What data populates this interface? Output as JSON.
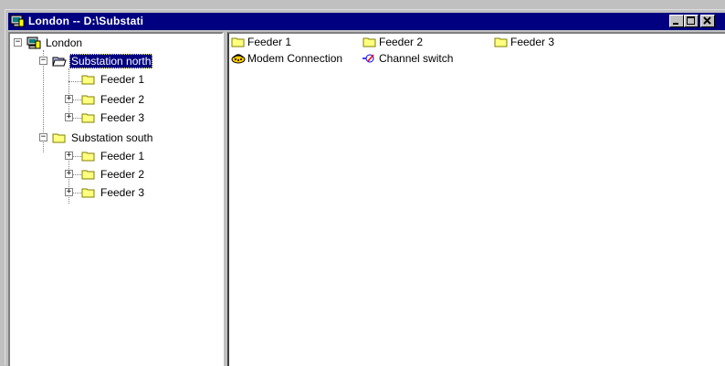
{
  "window": {
    "title": "London -- D:\\Substati"
  },
  "tree": {
    "root": "London",
    "children": [
      {
        "label": "Substation north",
        "selected": true,
        "children": [
          "Feeder 1",
          "Feeder 2",
          "Feeder 3"
        ]
      },
      {
        "label": "Substation south",
        "selected": false,
        "children": [
          "Feeder 1",
          "Feeder 2",
          "Feeder 3"
        ]
      }
    ]
  },
  "list": {
    "items": [
      {
        "label": "Feeder 1",
        "icon": "folder-icon"
      },
      {
        "label": "Feeder 2",
        "icon": "folder-icon"
      },
      {
        "label": "Feeder 3",
        "icon": "folder-icon"
      },
      {
        "label": "Modem Connection",
        "icon": "modem-icon"
      },
      {
        "label": "Channel switch",
        "icon": "channel-switch-icon"
      }
    ]
  },
  "colors": {
    "title_bar": "#000080",
    "folder": "#ffff80",
    "selection": "#000080"
  }
}
